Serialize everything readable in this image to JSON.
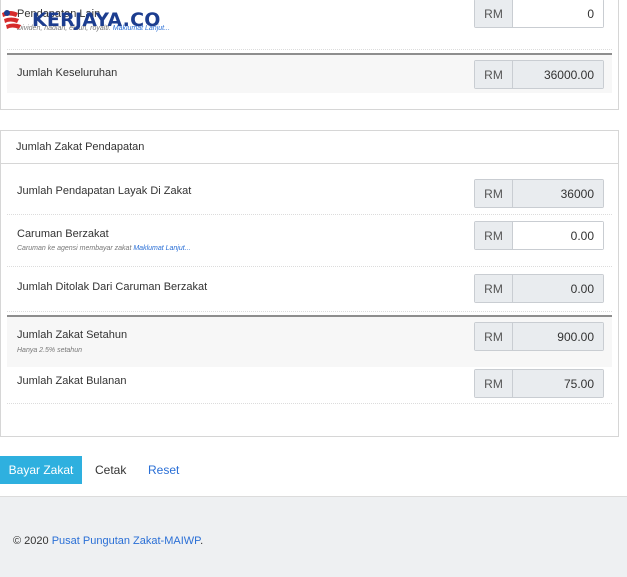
{
  "logo": {
    "text": "KERJAYA.CO"
  },
  "currency": "RM",
  "top_rows": [
    {
      "label": "Pendapatan Lain",
      "note": "Dividen, hadiah, elaun, royalti.",
      "note_link": "Maklumat Lanjut...",
      "value": "0"
    },
    {
      "label": "Jumlah Keseluruhan",
      "value": "36000.00"
    }
  ],
  "zakat_panel": {
    "title": "Jumlah Zakat Pendapatan",
    "rows": [
      {
        "label": "Jumlah Pendapatan Layak Di Zakat",
        "value": "36000"
      },
      {
        "label": "Caruman Berzakat",
        "note": "Caruman ke agensi membayar zakat",
        "note_link": "Maklumat Lanjut...",
        "value": "0.00"
      },
      {
        "label": "Jumlah Ditolak Dari Caruman Berzakat",
        "value": "0.00"
      },
      {
        "label": "Jumlah Zakat Setahun",
        "note": "Hanya 2.5% setahun",
        "value": "900.00"
      },
      {
        "label": "Jumlah Zakat Bulanan",
        "value": "75.00"
      }
    ]
  },
  "actions": {
    "pay": "Bayar Zakat",
    "print": "Cetak",
    "reset": "Reset"
  },
  "footer": {
    "copyright": "© 2020",
    "link": "Pusat Pungutan Zakat-MAIWP",
    "suffix": "."
  },
  "colors": {
    "primary": "#2eb0df",
    "link": "#2a6fd6",
    "logo": "#1c3d8f",
    "flag_red": "#d62b2b"
  }
}
